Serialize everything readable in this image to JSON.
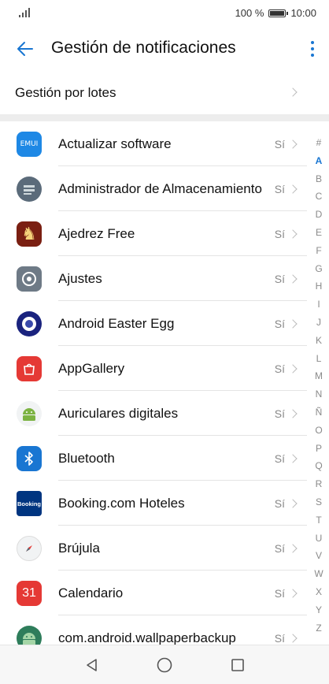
{
  "status_bar": {
    "battery_percent": "100 %",
    "time": "10:00"
  },
  "header": {
    "title": "Gestión de notificaciones"
  },
  "batch": {
    "label": "Gestión por lotes"
  },
  "apps": [
    {
      "name": "Actualizar software",
      "status": "Sí",
      "icon": "emui-icon"
    },
    {
      "name": "Administrador de Almacenamiento",
      "status": "Sí",
      "icon": "storage-manager-icon"
    },
    {
      "name": "Ajedrez Free",
      "status": "Sí",
      "icon": "chess-icon"
    },
    {
      "name": "Ajustes",
      "status": "Sí",
      "icon": "settings-icon"
    },
    {
      "name": "Android Easter Egg",
      "status": "Sí",
      "icon": "easter-egg-icon"
    },
    {
      "name": "AppGallery",
      "status": "Sí",
      "icon": "appgallery-icon"
    },
    {
      "name": "Auriculares digitales",
      "status": "Sí",
      "icon": "android-icon"
    },
    {
      "name": "Bluetooth",
      "status": "Sí",
      "icon": "bluetooth-icon"
    },
    {
      "name": "Booking.com Hoteles",
      "status": "Sí",
      "icon": "booking-icon"
    },
    {
      "name": "Brújula",
      "status": "Sí",
      "icon": "compass-icon"
    },
    {
      "name": "Calendario",
      "status": "Sí",
      "icon": "calendar-icon"
    },
    {
      "name": "com.android.wallpaperbackup",
      "status": "Sí",
      "icon": "android-icon"
    }
  ],
  "icon_labels": {
    "emui": "EMUI",
    "booking": "Booking",
    "calendar_day": "31"
  },
  "index_letters": [
    "#",
    "A",
    "B",
    "C",
    "D",
    "E",
    "F",
    "G",
    "H",
    "I",
    "J",
    "K",
    "L",
    "M",
    "N",
    "Ñ",
    "O",
    "P",
    "Q",
    "R",
    "S",
    "T",
    "U",
    "V",
    "W",
    "X",
    "Y",
    "Z"
  ],
  "index_active": "A",
  "colors": {
    "accent": "#1976d2",
    "divider": "#e4e4e4"
  }
}
